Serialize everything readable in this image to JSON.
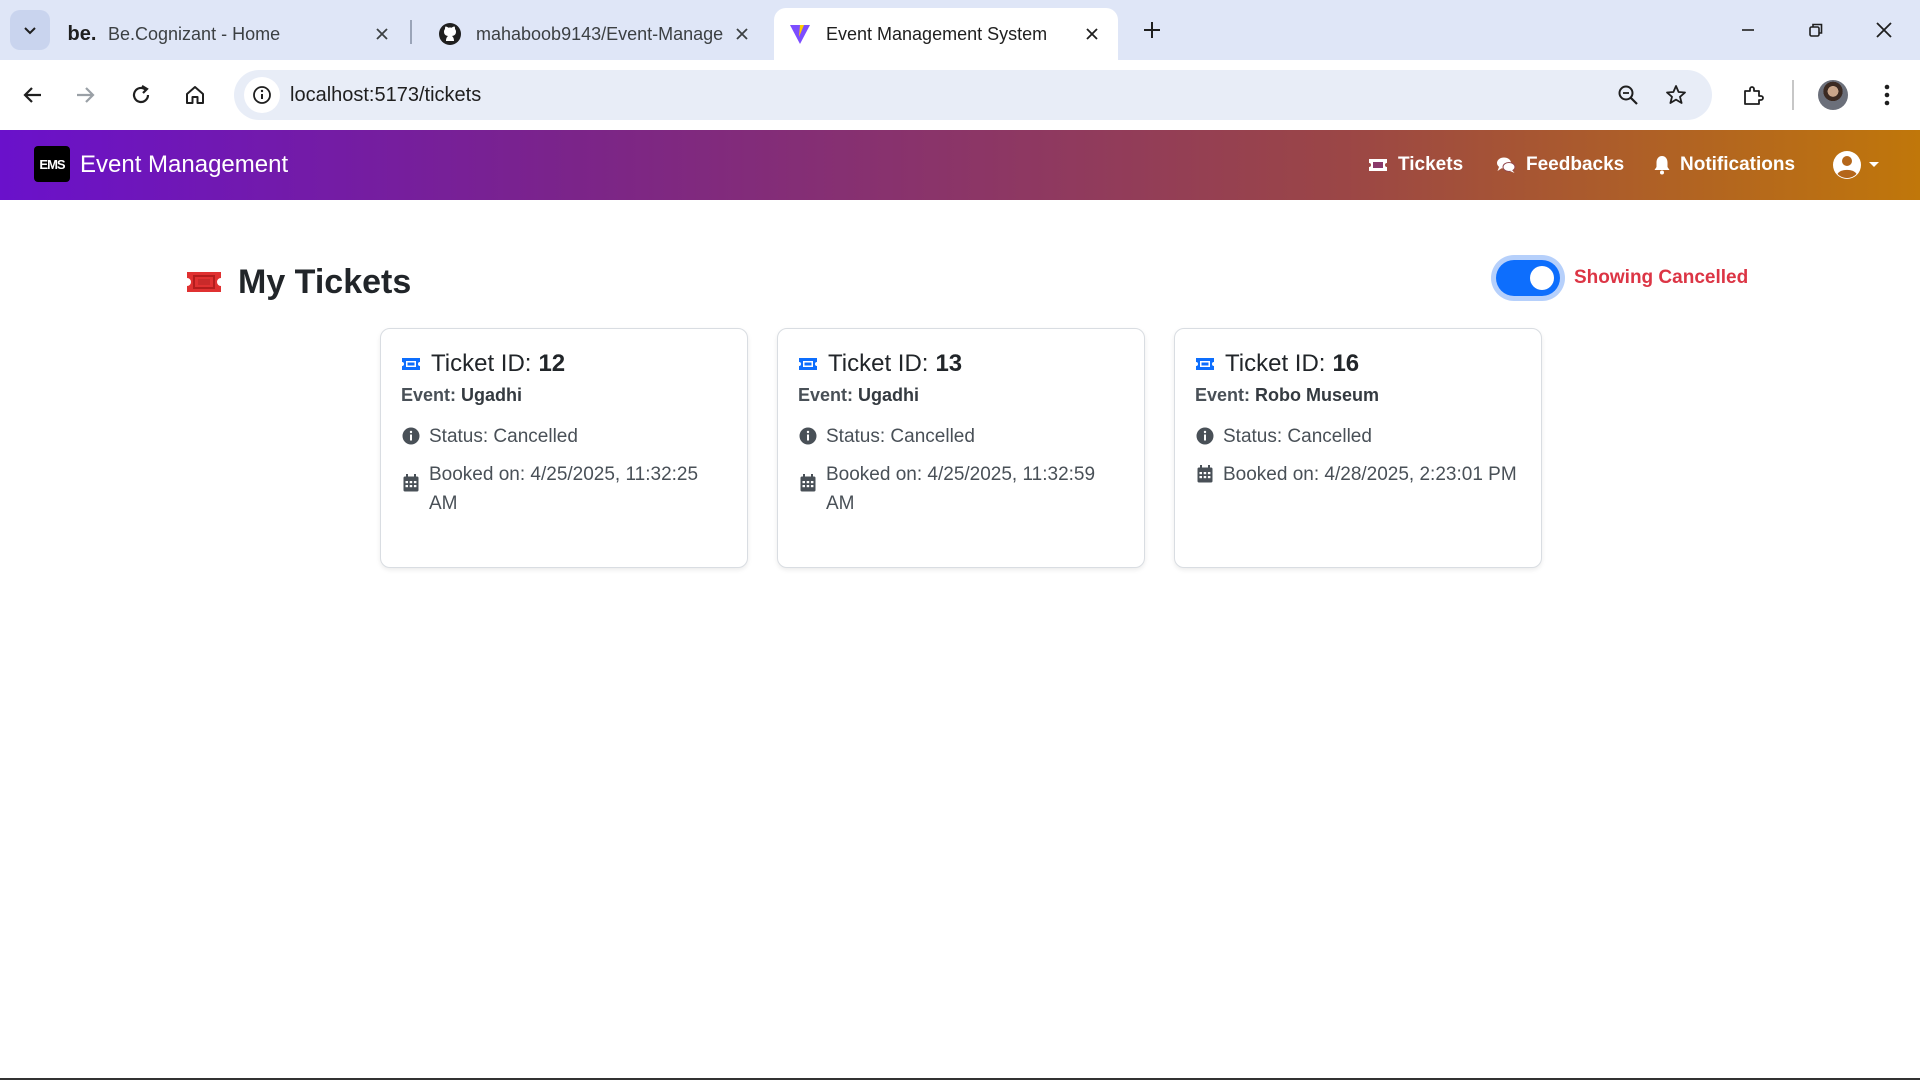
{
  "browser": {
    "tabs": [
      {
        "favicon_text": "be.",
        "title": "Be.Cognizant - Home"
      },
      {
        "title": "mahaboob9143/Event-Manage"
      },
      {
        "title": "Event Management System",
        "active": true
      }
    ],
    "url": "localhost:5173/tickets"
  },
  "app": {
    "brand": {
      "logo_text": "EMS",
      "name": "Event Management"
    },
    "nav": [
      {
        "label": "Tickets",
        "icon": "ticket-icon"
      },
      {
        "label": "Feedbacks",
        "icon": "chat-icon"
      },
      {
        "label": "Notifications",
        "icon": "bell-icon"
      }
    ],
    "user_icon": "user-circle-icon"
  },
  "page": {
    "title": "My Tickets",
    "toggle": {
      "label": "Showing Cancelled",
      "on": true
    }
  },
  "tickets": [
    {
      "id_label": "Ticket ID:",
      "id": "12",
      "event_label": "Event:",
      "event": "Ugadhi",
      "status": "Status: Cancelled",
      "booked_line1": "Booked on: 4/25/2025, 11:32:25",
      "booked_line2": "AM"
    },
    {
      "id_label": "Ticket ID:",
      "id": "13",
      "event_label": "Event:",
      "event": "Ugadhi",
      "status": "Status: Cancelled",
      "booked_line1": "Booked on: 4/25/2025, 11:32:59",
      "booked_line2": "AM"
    },
    {
      "id_label": "Ticket ID:",
      "id": "16",
      "event_label": "Event:",
      "event": "Robo Museum",
      "status": "Status: Cancelled",
      "booked_line1": "Booked on: 4/28/2025, 2:23:01 PM",
      "booked_line2": ""
    }
  ],
  "colors": {
    "accent": "#0d6efd",
    "cancelled": "#dc3545",
    "ticket_icon": "#0d6efd",
    "title_icon": "#e03131"
  }
}
